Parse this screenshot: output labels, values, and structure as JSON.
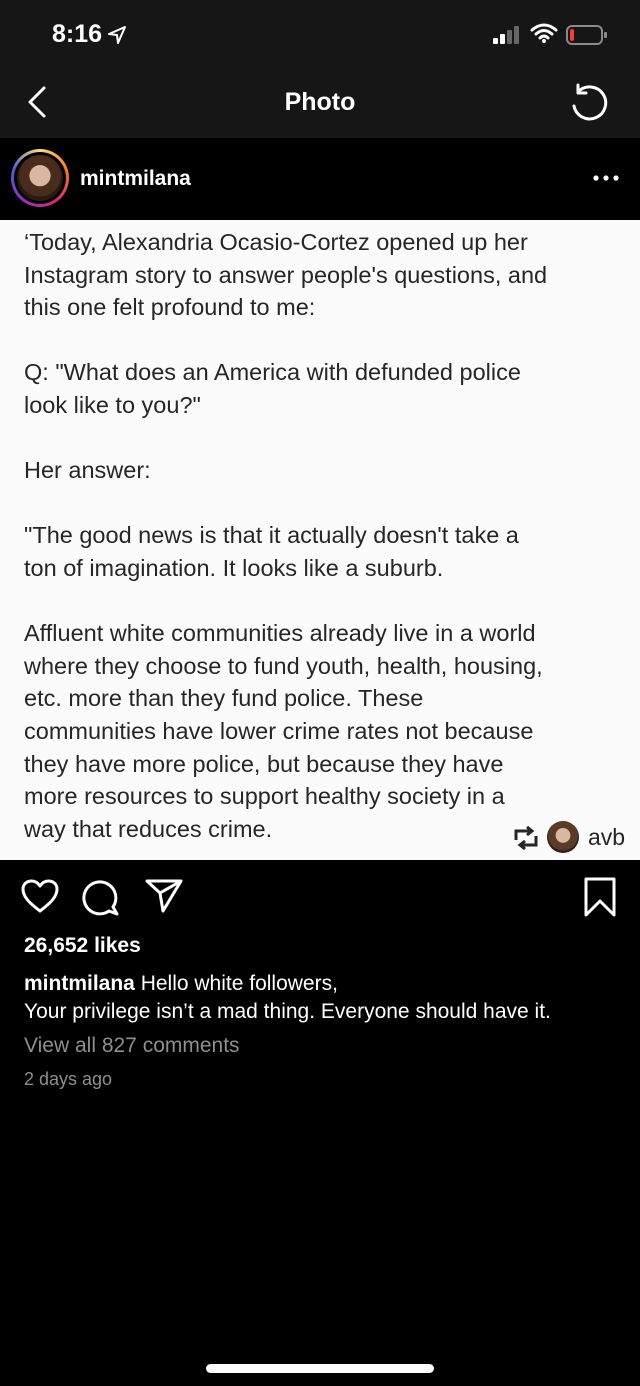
{
  "status_bar": {
    "time": "8:16"
  },
  "nav": {
    "title": "Photo"
  },
  "post": {
    "username": "mintmilana",
    "photo": {
      "paragraphs": [
        "‘Today, Alexandria Ocasio-Cortez opened up her\nInstagram story to answer people's questions, and\nthis one felt profound to me:",
        "Q: \"What does an America with defunded police\nlook like to you?\"",
        "Her answer:",
        "\"The good news is that it actually doesn't take a\nton of imagination. It looks like a suburb.",
        "Affluent white communities already live in a world\nwhere they choose to fund youth, health, housing,\netc. more than they fund police. These\ncommunities have lower crime rates not because\nthey have more police, but because they have\nmore resources to support healthy society in a\nway that reduces crime."
      ],
      "repost_name": "avb"
    },
    "likes": "26,652 likes",
    "caption": {
      "user": "mintmilana",
      "text": " Hello white followers,\nYour privilege isn’t a mad thing. Everyone should have it."
    },
    "view_comments": "View all 827 comments",
    "timestamp": "2 days ago"
  },
  "icons": {
    "location": "location-arrow-icon",
    "signal": "cellular-signal-icon",
    "wifi": "wifi-icon",
    "battery": "battery-low-icon",
    "back": "chevron-left-icon",
    "rotate": "rotate-icon",
    "more": "more-horizontal-icon",
    "heart": "heart-icon",
    "comment": "comment-icon",
    "share": "paper-plane-icon",
    "bookmark": "bookmark-icon",
    "repost": "repost-icon"
  },
  "colors": {
    "battery_low": "#ff3b30",
    "muted_text": "#8e8e8e",
    "bar_background": "#161616"
  }
}
